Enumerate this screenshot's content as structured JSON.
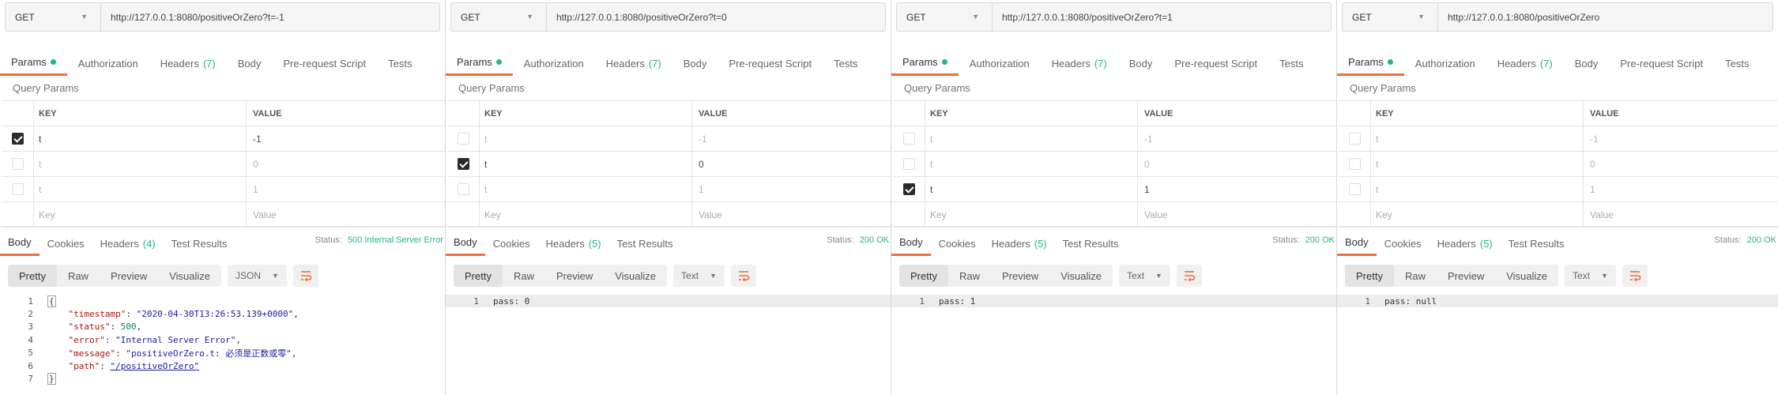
{
  "panels": [
    {
      "method": "GET",
      "url": "http://127.0.0.1:8080/positiveOrZero?t=-1",
      "tabs": {
        "params": "Params",
        "authorization": "Authorization",
        "headers": "Headers",
        "headers_count": "(7)",
        "body": "Body",
        "prerequest": "Pre-request Script",
        "tests": "Tests"
      },
      "query_params_label": "Query Params",
      "table_head": {
        "key": "KEY",
        "value": "VALUE"
      },
      "params": [
        {
          "key": "t",
          "value": "-1",
          "checked": true
        },
        {
          "key": "t",
          "value": "0",
          "checked": false
        },
        {
          "key": "t",
          "value": "1",
          "checked": false
        }
      ],
      "placeholder": {
        "key": "Key",
        "value": "Value"
      },
      "res_tabs": {
        "body": "Body",
        "cookies": "Cookies",
        "headers": "Headers",
        "headers_count": "(4)",
        "test_results": "Test Results"
      },
      "status_label": "Status:",
      "status_value": "500 Internal Server Error",
      "formats": [
        "Pretty",
        "Raw",
        "Preview",
        "Visualize"
      ],
      "language": "JSON",
      "code": [
        {
          "n": "1",
          "t": "{"
        },
        {
          "n": "2",
          "k": "\"timestamp\"",
          "v": "\"2020-04-30T13:26:53.139+0000\"",
          "vt": "s",
          "tail": ","
        },
        {
          "n": "3",
          "k": "\"status\"",
          "v": "500",
          "vt": "n",
          "tail": ","
        },
        {
          "n": "4",
          "k": "\"error\"",
          "v": "\"Internal Server Error\"",
          "vt": "s",
          "tail": ","
        },
        {
          "n": "5",
          "k": "\"message\"",
          "v": "\"positiveOrZero.t: 必须是正数或零\"",
          "vt": "s",
          "tail": ","
        },
        {
          "n": "6",
          "k": "\"path\"",
          "v": "\"/positiveOrZero\"",
          "vt": "u",
          "tail": ""
        },
        {
          "n": "7",
          "t": "}"
        }
      ]
    },
    {
      "method": "GET",
      "url": "http://127.0.0.1:8080/positiveOrZero?t=0",
      "tabs": {
        "params": "Params",
        "authorization": "Authorization",
        "headers": "Headers",
        "headers_count": "(7)",
        "body": "Body",
        "prerequest": "Pre-request Script",
        "tests": "Tests"
      },
      "query_params_label": "Query Params",
      "table_head": {
        "key": "KEY",
        "value": "VALUE"
      },
      "params": [
        {
          "key": "t",
          "value": "-1",
          "checked": false
        },
        {
          "key": "t",
          "value": "0",
          "checked": true
        },
        {
          "key": "t",
          "value": "1",
          "checked": false
        }
      ],
      "placeholder": {
        "key": "Key",
        "value": "Value"
      },
      "res_tabs": {
        "body": "Body",
        "cookies": "Cookies",
        "headers": "Headers",
        "headers_count": "(5)",
        "test_results": "Test Results"
      },
      "status_label": "Status:",
      "status_value": "200 OK",
      "formats": [
        "Pretty",
        "Raw",
        "Preview",
        "Visualize"
      ],
      "language": "Text",
      "code": [
        {
          "n": "1",
          "t": "pass: 0"
        }
      ]
    },
    {
      "method": "GET",
      "url": "http://127.0.0.1:8080/positiveOrZero?t=1",
      "tabs": {
        "params": "Params",
        "authorization": "Authorization",
        "headers": "Headers",
        "headers_count": "(7)",
        "body": "Body",
        "prerequest": "Pre-request Script",
        "tests": "Tests"
      },
      "query_params_label": "Query Params",
      "table_head": {
        "key": "KEY",
        "value": "VALUE"
      },
      "params": [
        {
          "key": "t",
          "value": "-1",
          "checked": false
        },
        {
          "key": "t",
          "value": "0",
          "checked": false
        },
        {
          "key": "t",
          "value": "1",
          "checked": true
        }
      ],
      "placeholder": {
        "key": "Key",
        "value": "Value"
      },
      "res_tabs": {
        "body": "Body",
        "cookies": "Cookies",
        "headers": "Headers",
        "headers_count": "(5)",
        "test_results": "Test Results"
      },
      "status_label": "Status:",
      "status_value": "200 OK",
      "formats": [
        "Pretty",
        "Raw",
        "Preview",
        "Visualize"
      ],
      "language": "Text",
      "code": [
        {
          "n": "1",
          "t": "pass: 1"
        }
      ]
    },
    {
      "method": "GET",
      "url": "http://127.0.0.1:8080/positiveOrZero",
      "tabs": {
        "params": "Params",
        "authorization": "Authorization",
        "headers": "Headers",
        "headers_count": "(7)",
        "body": "Body",
        "prerequest": "Pre-request Script",
        "tests": "Tests"
      },
      "query_params_label": "Query Params",
      "table_head": {
        "key": "KEY",
        "value": "VALUE"
      },
      "params": [
        {
          "key": "t",
          "value": "-1",
          "checked": false
        },
        {
          "key": "t",
          "value": "0",
          "checked": false
        },
        {
          "key": "t",
          "value": "1",
          "checked": false
        }
      ],
      "placeholder": {
        "key": "Key",
        "value": "Value"
      },
      "res_tabs": {
        "body": "Body",
        "cookies": "Cookies",
        "headers": "Headers",
        "headers_count": "(5)",
        "test_results": "Test Results"
      },
      "status_label": "Status:",
      "status_value": "200 OK",
      "formats": [
        "Pretty",
        "Raw",
        "Preview",
        "Visualize"
      ],
      "language": "Text",
      "code": [
        {
          "n": "1",
          "t": "pass: null"
        }
      ]
    }
  ]
}
